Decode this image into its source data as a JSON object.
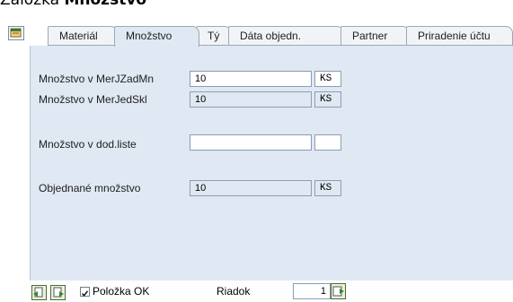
{
  "heading": {
    "prefix": "Záložka ",
    "bold": "Množstvo"
  },
  "tabs": [
    {
      "label": "Materiál",
      "active": false
    },
    {
      "label": "Množstvo",
      "active": true
    },
    {
      "label": "Tý",
      "active": false
    },
    {
      "label": "Dáta objedn.",
      "active": false
    },
    {
      "label": "Partner",
      "active": false
    },
    {
      "label": "Priradenie účtu",
      "active": false
    }
  ],
  "fields": {
    "qty_order_unit": {
      "label": "Množstvo v MerJZadMn",
      "value": "10",
      "unit": "KS"
    },
    "qty_stock_unit": {
      "label": "Množstvo v MerJedSkl",
      "value": "10",
      "unit": "KS"
    },
    "qty_delivery_note": {
      "label": "Množstvo v dod.liste",
      "value": "",
      "unit": ""
    },
    "qty_ordered": {
      "label": "Objednané množstvo",
      "value": "10",
      "unit": "KS"
    }
  },
  "bottom": {
    "item_ok_label": "Položka OK",
    "item_ok_checked": true,
    "row_label": "Riadok",
    "row_value": "1"
  }
}
